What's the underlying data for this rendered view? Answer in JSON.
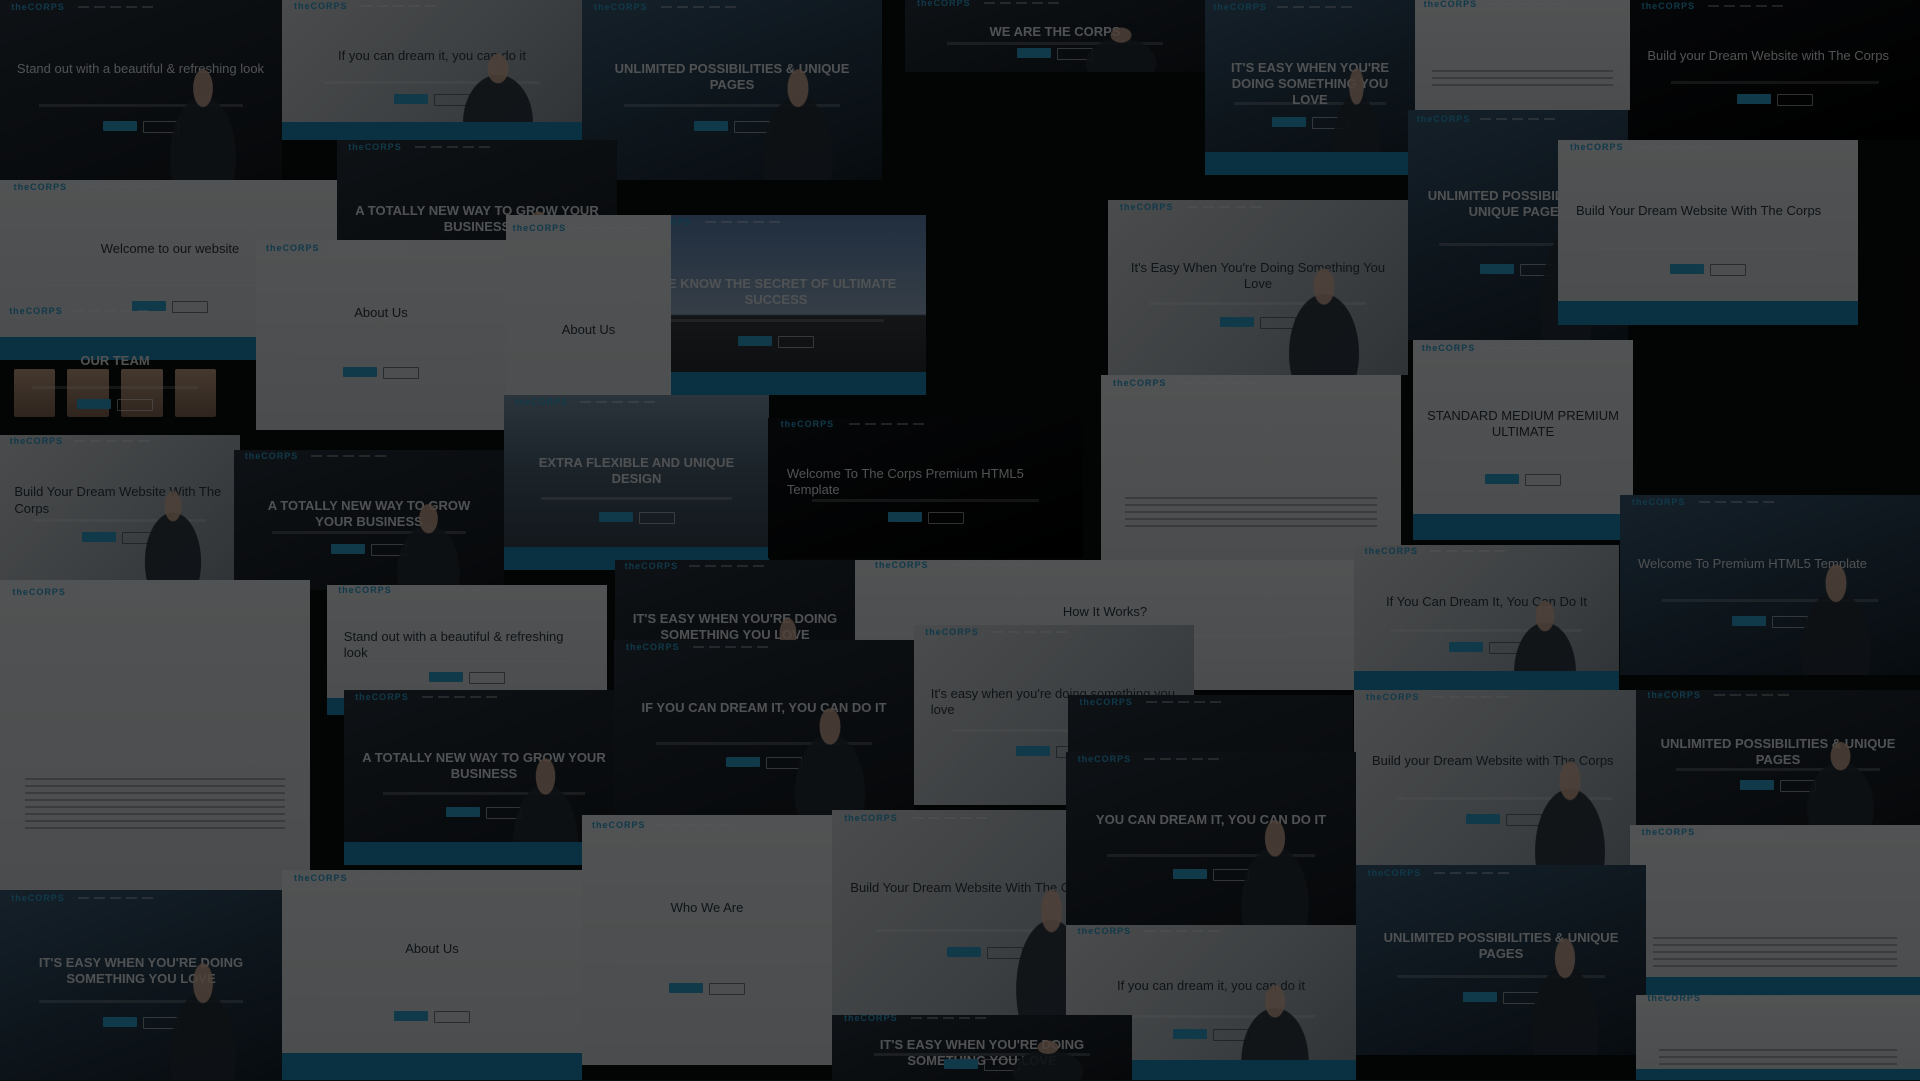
{
  "brand": "theCORPS",
  "colors": {
    "accent": "#2fa8d8",
    "band": "#1e8fbf",
    "overlay": "#000000"
  },
  "tiles": [
    {
      "style": "dark",
      "hero": "Stand out with a beautiful & refreshing look",
      "align": "left"
    },
    {
      "style": "photo-light",
      "hero": "If you can dream it, you can do it"
    },
    {
      "style": "blue",
      "hero": "UNLIMITED POSSIBILITIES & UNIQUE PAGES"
    },
    {
      "style": "dark",
      "hero": "We Are The Corps"
    },
    {
      "style": "blue",
      "hero": "IT'S EASY WHEN YOU'RE DOING SOMETHING YOU LOVE"
    },
    {
      "style": "light",
      "hero": ""
    },
    {
      "style": "night",
      "hero": "Build your Dream Website with The Corps",
      "align": "left"
    },
    {
      "style": "light",
      "hero": "Welcome to our website"
    },
    {
      "style": "dark",
      "hero": "A Totally New Way To Grow Your Business"
    },
    {
      "style": "light",
      "hero": "About Us"
    },
    {
      "style": "pier",
      "hero": "WE KNOW THE SECRET OF ULTIMATE SUCCESS"
    },
    {
      "style": "photo-light",
      "hero": "It's Easy When You're Doing Something You Love"
    },
    {
      "style": "blue",
      "hero": "UNLIMITED POSSIBILITIES & UNIQUE PAGES"
    },
    {
      "style": "light",
      "hero": "Build Your Dream Website With The Corps",
      "align": "left"
    },
    {
      "style": "team",
      "hero": "Our Team"
    },
    {
      "style": "light",
      "hero": "About Us"
    },
    {
      "style": "city",
      "hero": "EXTRA FLEXIBLE AND UNIQUE DESIGN"
    },
    {
      "style": "night",
      "hero": "Welcome To The Corps Premium HTML5 Template",
      "align": "left"
    },
    {
      "style": "light",
      "hero": ""
    },
    {
      "style": "light",
      "hero": "STANDARD  MEDIUM  PREMIUM  ULTIMATE"
    },
    {
      "style": "photo-light",
      "hero": "Build Your Dream Website With The Corps",
      "align": "left"
    },
    {
      "style": "dark",
      "hero": "A Totally New Way To Grow Your Business"
    },
    {
      "style": "light",
      "hero": "Stand out with a beautiful & refreshing look",
      "align": "left"
    },
    {
      "style": "dark",
      "hero": "IT'S EASY WHEN YOU'RE DOING SOMETHING YOU LOVE"
    },
    {
      "style": "light",
      "hero": "How It Works?"
    },
    {
      "style": "photo-light",
      "hero": "If You Can Dream It, You Can Do It"
    },
    {
      "style": "blue",
      "hero": "Welcome To Premium HTML5 Template",
      "align": "left"
    },
    {
      "style": "light",
      "hero": ""
    },
    {
      "style": "dark",
      "hero": "A Totally New Way To Grow Your Business"
    },
    {
      "style": "dark",
      "hero": "IF YOU CAN DREAM IT, YOU CAN DO IT"
    },
    {
      "style": "photo-light",
      "hero": "It's easy when you're doing something you love",
      "align": "left"
    },
    {
      "style": "dark",
      "hero": ""
    },
    {
      "style": "photo-light",
      "hero": "Build your Dream Website with The Corps",
      "align": "left"
    },
    {
      "style": "dark",
      "hero": "Unlimited Possibilities & Unique Pages"
    },
    {
      "style": "light",
      "hero": ""
    },
    {
      "style": "photo-light",
      "hero": "Build Your Dream Website With The Corps",
      "align": "left"
    },
    {
      "style": "dark",
      "hero": "YOU CAN DREAM IT, YOU CAN DO IT"
    },
    {
      "style": "light",
      "hero": "About Us"
    },
    {
      "style": "light",
      "hero": "Who We Are"
    },
    {
      "style": "blue",
      "hero": "IT'S EASY WHEN YOU'RE DOING SOMETHING YOU LOVE"
    },
    {
      "style": "photo-light",
      "hero": "If you can dream it, you can do it"
    },
    {
      "style": "blue",
      "hero": "UNLIMITED POSSIBILITIES & UNIQUE PAGES"
    },
    {
      "style": "dark",
      "hero": "IT'S EASY WHEN YOU'RE DOING SOMETHING YOU LOVE"
    },
    {
      "style": "light",
      "hero": ""
    }
  ]
}
